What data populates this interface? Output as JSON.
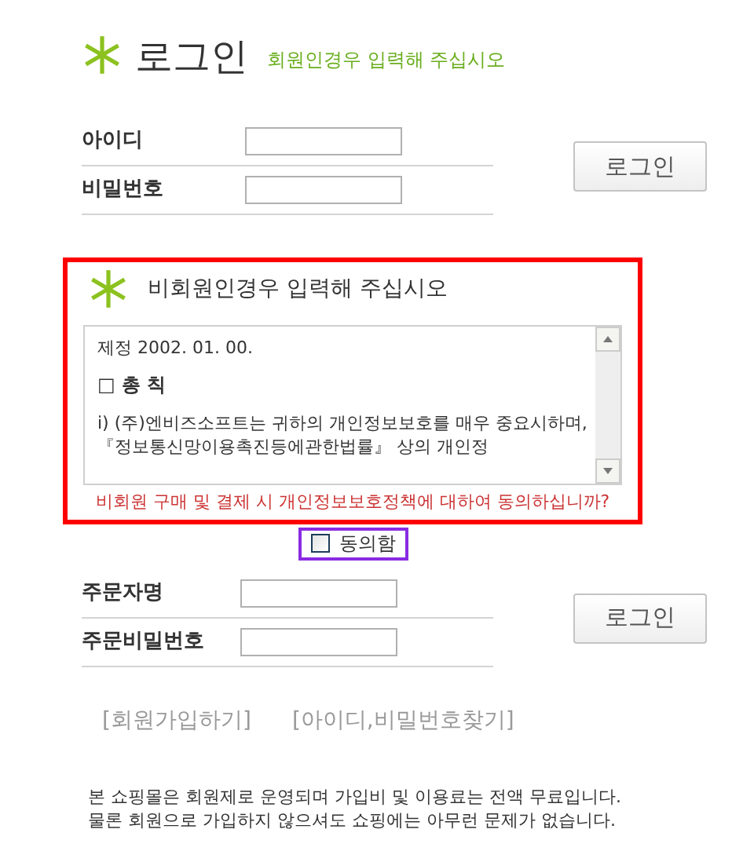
{
  "member_login": {
    "title": "로그인",
    "subtitle": "회원인경우 입력해 주십시오",
    "fields": [
      {
        "label": "아이디"
      },
      {
        "label": "비밀번호"
      }
    ],
    "button": "로그인"
  },
  "guest": {
    "title": "비회원인경우 입력해 주십시오",
    "terms": [
      "제정 2002. 01. 00.",
      "□ 총 칙",
      "ⅰ) (주)엔비즈소프트는 귀하의 개인정보보호를 매우 중요시하며, 『정보통신망이용촉진등에관한법률』 상의 개인정"
    ],
    "question": "비회원 구매 및 결제 시 개인정보보호정책에 대하여 동의하십니까?",
    "agree": {
      "label": "동의함",
      "checked": false
    }
  },
  "guest_login": {
    "fields": [
      {
        "label": "주문자명"
      },
      {
        "label": "주문비밀번호"
      }
    ],
    "button": "로그인"
  },
  "links": [
    "[회원가입하기]",
    "[아이디,비밀번호찾기]"
  ],
  "footer": [
    "본 쇼핑몰은 회원제로 운영되며 가입비 및 이용료는 전액 무료입니다.",
    "물론 회원으로 가입하지 않으셔도 쇼핑에는 아무런 문제가 없습니다."
  ]
}
